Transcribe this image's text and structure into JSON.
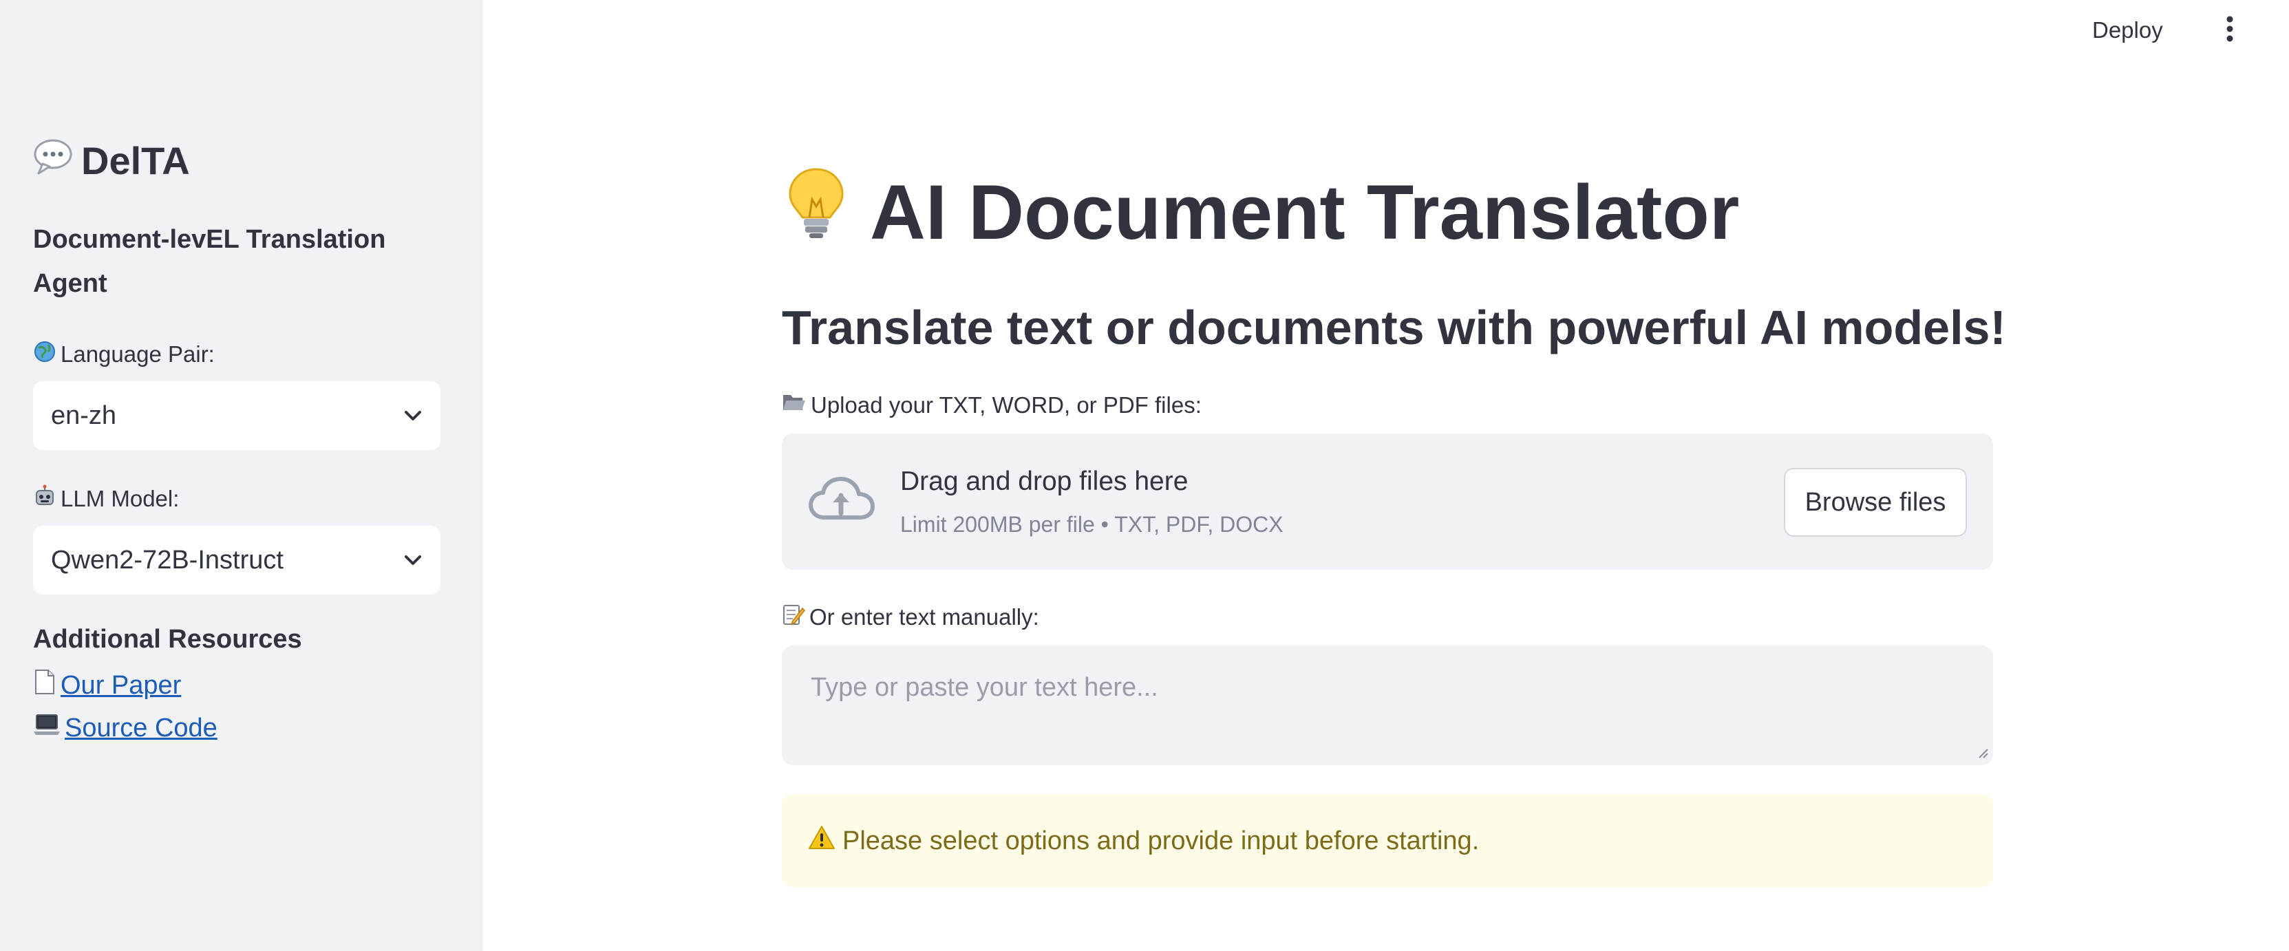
{
  "sidebar": {
    "title": "DelTA",
    "title_icon": "speech-bubble-icon",
    "subtitle": "Document-levEL Translation Agent",
    "language_pair": {
      "label": "Language Pair:",
      "icon": "globe-icon",
      "selected": "en-zh"
    },
    "llm_model": {
      "label": "LLM Model:",
      "icon": "robot-icon",
      "selected": "Qwen2-72B-Instruct"
    },
    "resources": {
      "heading": "Additional Resources",
      "links": [
        {
          "label": "Our Paper",
          "icon": "document-icon"
        },
        {
          "label": "Source Code",
          "icon": "laptop-icon"
        }
      ]
    }
  },
  "header": {
    "deploy_label": "Deploy",
    "menu_icon": "more-vertical-icon"
  },
  "main": {
    "title": "AI Document Translator",
    "title_icon": "lightbulb-icon",
    "subtitle": "Translate text or documents with powerful AI models!",
    "upload": {
      "label": "Upload your TXT, WORD, or PDF files:",
      "label_icon": "open-folder-icon",
      "drop_title": "Drag and drop files here",
      "drop_limit": "Limit 200MB per file • TXT, PDF, DOCX",
      "browse_label": "Browse files",
      "upload_icon": "cloud-upload-icon"
    },
    "manual": {
      "label": "Or enter text manually:",
      "label_icon": "memo-icon",
      "placeholder": "Type or paste your text here...",
      "value": ""
    },
    "warning": {
      "icon": "warning-icon",
      "text": "Please select options and provide input before starting."
    }
  },
  "colors": {
    "sidebar_bg": "#f0f2f6",
    "link": "#1c5bb8",
    "warning_bg": "#fffce7",
    "warning_text": "#7c6b1a"
  }
}
